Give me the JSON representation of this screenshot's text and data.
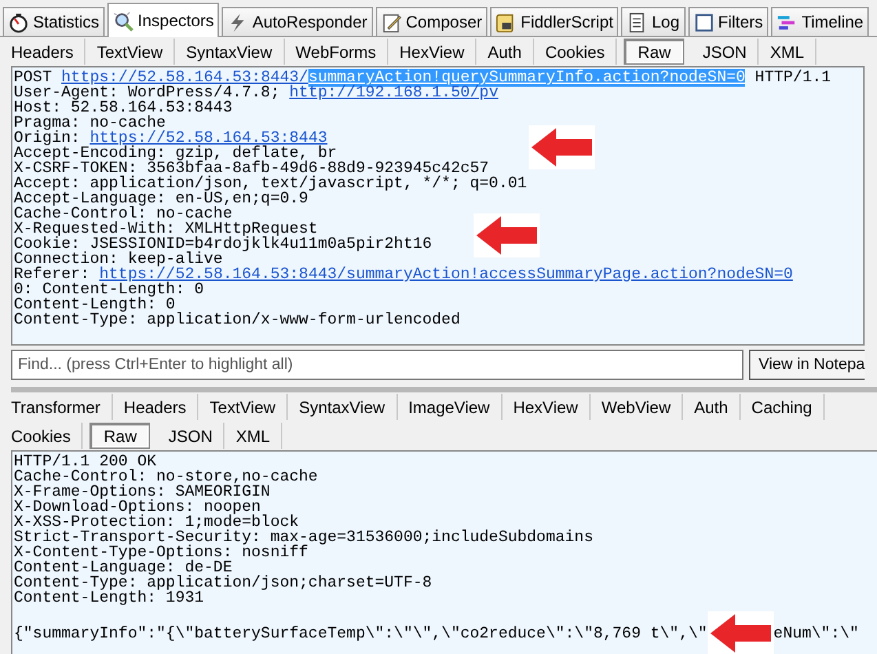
{
  "main_tabs": [
    {
      "label": "Statistics",
      "selected": false
    },
    {
      "label": "Inspectors",
      "selected": true
    },
    {
      "label": "AutoResponder",
      "selected": false
    },
    {
      "label": "Composer",
      "selected": false
    },
    {
      "label": "FiddlerScript",
      "selected": false
    },
    {
      "label": "Log",
      "selected": false
    },
    {
      "label": "Filters",
      "selected": false
    },
    {
      "label": "Timeline",
      "selected": false
    }
  ],
  "request": {
    "tabs": [
      {
        "label": "Headers",
        "selected": false
      },
      {
        "label": "TextView",
        "selected": false
      },
      {
        "label": "SyntaxView",
        "selected": false
      },
      {
        "label": "WebForms",
        "selected": false
      },
      {
        "label": "HexView",
        "selected": false
      },
      {
        "label": "Auth",
        "selected": false
      },
      {
        "label": "Cookies",
        "selected": false
      },
      {
        "label": "Raw",
        "selected": true
      },
      {
        "label": "JSON",
        "selected": false
      },
      {
        "label": "XML",
        "selected": false
      }
    ],
    "lines": [
      [
        {
          "kind": "plain",
          "text": "POST "
        },
        {
          "kind": "link",
          "text": "https://52.58.164.53:8443/"
        },
        {
          "kind": "highlighted",
          "text": "summaryAction!querySummaryInfo.action?nodeSN=0"
        },
        {
          "kind": "plain",
          "text": " HTTP/1.1"
        }
      ],
      [
        {
          "kind": "plain",
          "text": "User-Agent: WordPress/4.7.8; "
        },
        {
          "kind": "link",
          "text": "http://192.168.1.50/pv"
        }
      ],
      [
        {
          "kind": "plain",
          "text": "Host: 52.58.164.53:8443"
        }
      ],
      [
        {
          "kind": "plain",
          "text": "Pragma: no-cache"
        }
      ],
      [
        {
          "kind": "plain",
          "text": "Origin: "
        },
        {
          "kind": "link",
          "text": "https://52.58.164.53:8443"
        }
      ],
      [
        {
          "kind": "plain",
          "text": "Accept-Encoding: gzip, deflate, br"
        }
      ],
      [
        {
          "kind": "plain",
          "text": "X-CSRF-TOKEN: 3563bfaa-8afb-49d6-88d9-923945c42c57"
        }
      ],
      [
        {
          "kind": "plain",
          "text": "Accept: application/json, text/javascript, */*; q=0.01"
        }
      ],
      [
        {
          "kind": "plain",
          "text": "Accept-Language: en-US,en;q=0.9"
        }
      ],
      [
        {
          "kind": "plain",
          "text": "Cache-Control: no-cache"
        }
      ],
      [
        {
          "kind": "plain",
          "text": "X-Requested-With: XMLHttpRequest"
        }
      ],
      [
        {
          "kind": "plain",
          "text": "Cookie: JSESSIONID=b4rdojklk4u11m0a5pir2ht16"
        }
      ],
      [
        {
          "kind": "plain",
          "text": "Connection: keep-alive"
        }
      ],
      [
        {
          "kind": "plain",
          "text": "Referer: "
        },
        {
          "kind": "link",
          "text": "https://52.58.164.53:8443/summaryAction!accessSummaryPage.action?nodeSN=0"
        }
      ],
      [
        {
          "kind": "plain",
          "text": "0: Content-Length: 0"
        }
      ],
      [
        {
          "kind": "plain",
          "text": "Content-Length: 0"
        }
      ],
      [
        {
          "kind": "plain",
          "text": "Content-Type: application/x-www-form-urlencoded"
        }
      ]
    ]
  },
  "find": {
    "placeholder": "Find... (press Ctrl+Enter to highlight all)",
    "button": "View in Notepa"
  },
  "response": {
    "tab_rows": [
      [
        {
          "label": "Transformer",
          "selected": false
        },
        {
          "label": "Headers",
          "selected": false
        },
        {
          "label": "TextView",
          "selected": false
        },
        {
          "label": "SyntaxView",
          "selected": false
        },
        {
          "label": "ImageView",
          "selected": false
        },
        {
          "label": "HexView",
          "selected": false
        },
        {
          "label": "WebView",
          "selected": false
        },
        {
          "label": "Auth",
          "selected": false
        },
        {
          "label": "Caching",
          "selected": false
        }
      ],
      [
        {
          "label": "Cookies",
          "selected": false
        },
        {
          "label": "Raw",
          "selected": true
        },
        {
          "label": "JSON",
          "selected": false
        },
        {
          "label": "XML",
          "selected": false
        }
      ]
    ],
    "headers": [
      "HTTP/1.1 200 OK",
      "Cache-Control: no-store,no-cache",
      "X-Frame-Options: SAMEORIGIN",
      "X-Download-Options: noopen",
      "X-XSS-Protection: 1;mode=block",
      "Strict-Transport-Security: max-age=31536000;includeSubdomains",
      "X-Content-Type-Options: nosniff",
      "Content-Language: de-DE",
      "Content-Type: application/json;charset=UTF-8",
      "Content-Length: 1931"
    ],
    "body": [
      {
        "kind": "plain",
        "text": "{\"summaryInfo\":\"{\\\"batterySurfaceTemp\\\":\\\"\\\",\\\"co2reduce\\\":\\\"8,769 t\\\",\\\""
      },
      {
        "kind": "arrow"
      },
      {
        "kind": "plain",
        "text": "eNum\\\":\\\""
      }
    ]
  }
}
